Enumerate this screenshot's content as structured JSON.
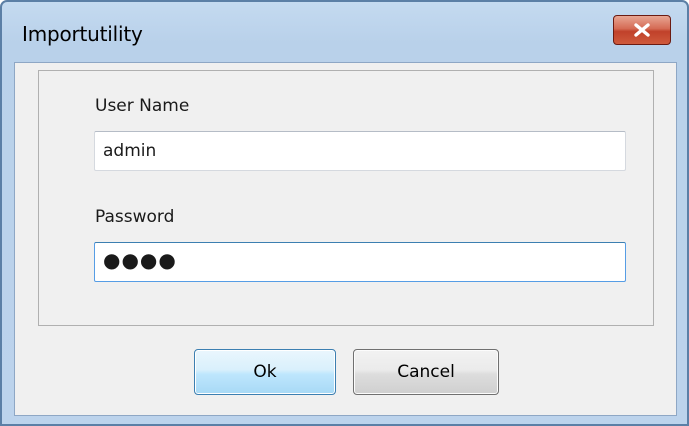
{
  "window": {
    "title": "Importutility",
    "close_icon": "close-icon"
  },
  "form": {
    "username_label": "User Name",
    "username_value": "admin",
    "password_label": "Password",
    "password_masked": "●●●●"
  },
  "buttons": {
    "ok_label": "Ok",
    "cancel_label": "Cancel"
  },
  "colors": {
    "titlebar": "#b9d1ea",
    "close_button": "#c0412a",
    "focused_border": "#569de5",
    "client_background": "#f0f0f0"
  }
}
